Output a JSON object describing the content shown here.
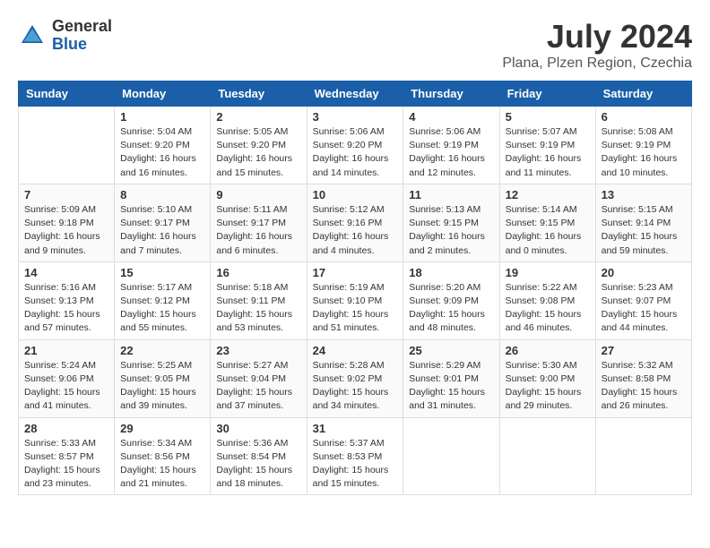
{
  "header": {
    "logo_general": "General",
    "logo_blue": "Blue",
    "month_year": "July 2024",
    "location": "Plana, Plzen Region, Czechia"
  },
  "calendar": {
    "days_of_week": [
      "Sunday",
      "Monday",
      "Tuesday",
      "Wednesday",
      "Thursday",
      "Friday",
      "Saturday"
    ],
    "weeks": [
      [
        {
          "day": "",
          "info": ""
        },
        {
          "day": "1",
          "info": "Sunrise: 5:04 AM\nSunset: 9:20 PM\nDaylight: 16 hours\nand 16 minutes."
        },
        {
          "day": "2",
          "info": "Sunrise: 5:05 AM\nSunset: 9:20 PM\nDaylight: 16 hours\nand 15 minutes."
        },
        {
          "day": "3",
          "info": "Sunrise: 5:06 AM\nSunset: 9:20 PM\nDaylight: 16 hours\nand 14 minutes."
        },
        {
          "day": "4",
          "info": "Sunrise: 5:06 AM\nSunset: 9:19 PM\nDaylight: 16 hours\nand 12 minutes."
        },
        {
          "day": "5",
          "info": "Sunrise: 5:07 AM\nSunset: 9:19 PM\nDaylight: 16 hours\nand 11 minutes."
        },
        {
          "day": "6",
          "info": "Sunrise: 5:08 AM\nSunset: 9:19 PM\nDaylight: 16 hours\nand 10 minutes."
        }
      ],
      [
        {
          "day": "7",
          "info": "Sunrise: 5:09 AM\nSunset: 9:18 PM\nDaylight: 16 hours\nand 9 minutes."
        },
        {
          "day": "8",
          "info": "Sunrise: 5:10 AM\nSunset: 9:17 PM\nDaylight: 16 hours\nand 7 minutes."
        },
        {
          "day": "9",
          "info": "Sunrise: 5:11 AM\nSunset: 9:17 PM\nDaylight: 16 hours\nand 6 minutes."
        },
        {
          "day": "10",
          "info": "Sunrise: 5:12 AM\nSunset: 9:16 PM\nDaylight: 16 hours\nand 4 minutes."
        },
        {
          "day": "11",
          "info": "Sunrise: 5:13 AM\nSunset: 9:15 PM\nDaylight: 16 hours\nand 2 minutes."
        },
        {
          "day": "12",
          "info": "Sunrise: 5:14 AM\nSunset: 9:15 PM\nDaylight: 16 hours\nand 0 minutes."
        },
        {
          "day": "13",
          "info": "Sunrise: 5:15 AM\nSunset: 9:14 PM\nDaylight: 15 hours\nand 59 minutes."
        }
      ],
      [
        {
          "day": "14",
          "info": "Sunrise: 5:16 AM\nSunset: 9:13 PM\nDaylight: 15 hours\nand 57 minutes."
        },
        {
          "day": "15",
          "info": "Sunrise: 5:17 AM\nSunset: 9:12 PM\nDaylight: 15 hours\nand 55 minutes."
        },
        {
          "day": "16",
          "info": "Sunrise: 5:18 AM\nSunset: 9:11 PM\nDaylight: 15 hours\nand 53 minutes."
        },
        {
          "day": "17",
          "info": "Sunrise: 5:19 AM\nSunset: 9:10 PM\nDaylight: 15 hours\nand 51 minutes."
        },
        {
          "day": "18",
          "info": "Sunrise: 5:20 AM\nSunset: 9:09 PM\nDaylight: 15 hours\nand 48 minutes."
        },
        {
          "day": "19",
          "info": "Sunrise: 5:22 AM\nSunset: 9:08 PM\nDaylight: 15 hours\nand 46 minutes."
        },
        {
          "day": "20",
          "info": "Sunrise: 5:23 AM\nSunset: 9:07 PM\nDaylight: 15 hours\nand 44 minutes."
        }
      ],
      [
        {
          "day": "21",
          "info": "Sunrise: 5:24 AM\nSunset: 9:06 PM\nDaylight: 15 hours\nand 41 minutes."
        },
        {
          "day": "22",
          "info": "Sunrise: 5:25 AM\nSunset: 9:05 PM\nDaylight: 15 hours\nand 39 minutes."
        },
        {
          "day": "23",
          "info": "Sunrise: 5:27 AM\nSunset: 9:04 PM\nDaylight: 15 hours\nand 37 minutes."
        },
        {
          "day": "24",
          "info": "Sunrise: 5:28 AM\nSunset: 9:02 PM\nDaylight: 15 hours\nand 34 minutes."
        },
        {
          "day": "25",
          "info": "Sunrise: 5:29 AM\nSunset: 9:01 PM\nDaylight: 15 hours\nand 31 minutes."
        },
        {
          "day": "26",
          "info": "Sunrise: 5:30 AM\nSunset: 9:00 PM\nDaylight: 15 hours\nand 29 minutes."
        },
        {
          "day": "27",
          "info": "Sunrise: 5:32 AM\nSunset: 8:58 PM\nDaylight: 15 hours\nand 26 minutes."
        }
      ],
      [
        {
          "day": "28",
          "info": "Sunrise: 5:33 AM\nSunset: 8:57 PM\nDaylight: 15 hours\nand 23 minutes."
        },
        {
          "day": "29",
          "info": "Sunrise: 5:34 AM\nSunset: 8:56 PM\nDaylight: 15 hours\nand 21 minutes."
        },
        {
          "day": "30",
          "info": "Sunrise: 5:36 AM\nSunset: 8:54 PM\nDaylight: 15 hours\nand 18 minutes."
        },
        {
          "day": "31",
          "info": "Sunrise: 5:37 AM\nSunset: 8:53 PM\nDaylight: 15 hours\nand 15 minutes."
        },
        {
          "day": "",
          "info": ""
        },
        {
          "day": "",
          "info": ""
        },
        {
          "day": "",
          "info": ""
        }
      ]
    ]
  }
}
